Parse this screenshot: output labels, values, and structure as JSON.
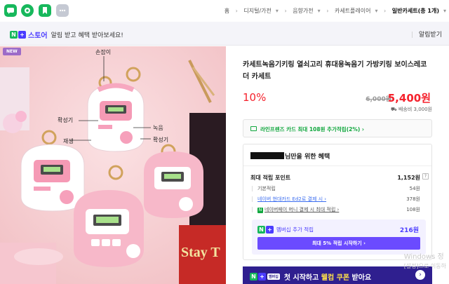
{
  "top_apps": [
    {
      "name": "talk-app-icon",
      "color": "#17b85c"
    },
    {
      "name": "pay-app-icon",
      "color": "#17b85c"
    },
    {
      "name": "bookmark-app-icon",
      "color": "#17b85c"
    },
    {
      "name": "more-app-icon",
      "color": "#c5c9d3"
    }
  ],
  "breadcrumb": {
    "home": "홈",
    "c1": "디지털/가전",
    "c2": "음향가전",
    "c3": "카세트플레이어",
    "c4": "일반카세트(총 1개)"
  },
  "notice": {
    "store_label": "스토어",
    "message": "알림 받고 혜택 받아보세요!",
    "action": "알림받기",
    "n_letter": "N",
    "plus_letter": "+"
  },
  "image": {
    "badge": "NEW",
    "labels": {
      "handle": "손잡이",
      "record": "녹음",
      "play": "재생",
      "volume": "확성기",
      "volume2": "확성기"
    },
    "book_text": "Stay T"
  },
  "product": {
    "title": "카세트녹음기키링 열쇠고리 휴대용녹음기 가방키링 보이스레코더 카세트",
    "discount": "10%",
    "original_price": "6,000원",
    "sale_price": "5,400원",
    "shipping": "배송비 3,000원",
    "card_promo": "라인프렌즈 카드 최대 108원 추가적립(2%) ›"
  },
  "benefit": {
    "header_suffix": "님만을 위한 혜택",
    "max_label": "최대 적립 포인트",
    "max_value": "1,152원",
    "help": "?",
    "rows": [
      {
        "label": "기본적립",
        "value": "54원"
      },
      {
        "label": "네이버 현대카드 Ed2로 결제 시 ›",
        "value": "378원"
      },
      {
        "label": "네이버페이 머니 결제 시 최대 적립 ›",
        "value": "108원"
      }
    ],
    "member_label": "멤버십 추가 적립",
    "member_value": "216원",
    "member_button": "최대 5% 적립 시작하기 ›"
  },
  "promo": {
    "tag": "멤버십",
    "text_prefix": "첫 시작하고 ",
    "text_highlight": "웰컴 쿠폰",
    "text_suffix": " 받아요",
    "arrow": "›"
  },
  "watermark": {
    "line1": "Windows 정",
    "line2": "[설정]으로 이동하"
  },
  "colors": {
    "accent": "#4b3cff",
    "sale": "#f5222d",
    "green": "#10a73e"
  }
}
